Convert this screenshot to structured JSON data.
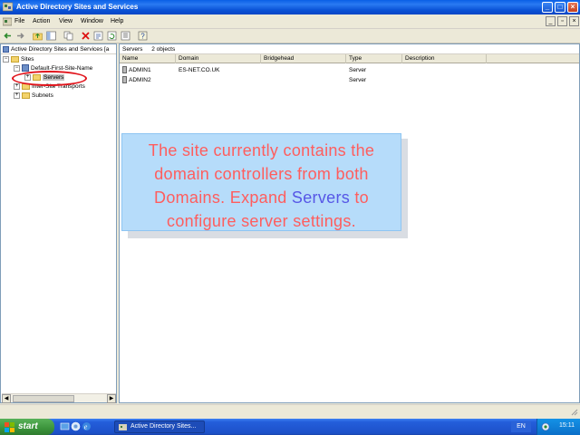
{
  "window": {
    "title": "Active Directory Sites and Services",
    "buttons": {
      "minimize": "_",
      "maximize": "□",
      "close": "×"
    }
  },
  "menubar": {
    "items": [
      "File",
      "Action",
      "View",
      "Window",
      "Help"
    ]
  },
  "tree": {
    "root_label": "Active Directory Sites and Services [a",
    "nodes": {
      "sites": "Sites",
      "default_site": "Default-First-Site-Name",
      "servers": "Servers",
      "inter_site": "Inter-Site Transports",
      "subnets": "Subnets"
    }
  },
  "list": {
    "header_title": "Servers",
    "header_count": "2 objects",
    "columns": [
      "Name",
      "Domain",
      "Bridgehead",
      "Type",
      "Description"
    ],
    "rows": [
      {
        "name": "ADMIN1",
        "domain": "ES-NET.CO.UK",
        "bridgehead": "",
        "type": "Server",
        "description": ""
      },
      {
        "name": "ADMIN2",
        "domain": "",
        "bridgehead": "",
        "type": "Server",
        "description": ""
      }
    ]
  },
  "callout": {
    "text_before": "The site currently contains the domain controllers from both Domains. Expand ",
    "keyword": "Servers",
    "text_after": " to configure server settings."
  },
  "taskbar": {
    "start_label": "start",
    "task_label": "Active Directory Sites...",
    "language": "EN",
    "clock": "15:11"
  },
  "colors": {
    "callout_text": "#ff5d5d",
    "callout_keyword": "#5656e6",
    "callout_bg": "#b6dcfa",
    "highlight_ellipse": "#e1141c"
  }
}
